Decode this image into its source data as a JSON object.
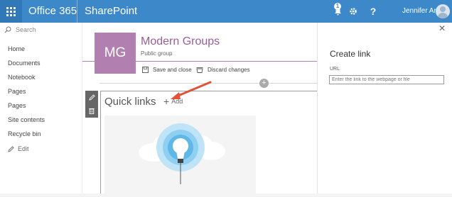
{
  "topbar": {
    "app_name": "Office 365",
    "product": "SharePoint",
    "notification_count": "1",
    "help_label": "?",
    "user_name": "Jennifer Ann"
  },
  "leftnav": {
    "search_placeholder": "Search",
    "items": [
      {
        "label": "Home"
      },
      {
        "label": "Documents"
      },
      {
        "label": "Notebook"
      },
      {
        "label": "Pages"
      },
      {
        "label": "Pages"
      },
      {
        "label": "Site contents"
      },
      {
        "label": "Recycle bin"
      }
    ],
    "edit_label": "Edit"
  },
  "site": {
    "logo_initials": "MG",
    "title": "Modern Groups",
    "subtitle": "Public group",
    "logo_color": "#b17fb0"
  },
  "commands": {
    "save_label": "Save and close",
    "discard_label": "Discard changes"
  },
  "webpart": {
    "title": "Quick links",
    "add_label": "Add"
  },
  "panel": {
    "title": "Create link",
    "url_label": "URL",
    "url_placeholder": "Enter the link to the webpage or file",
    "url_value": ""
  },
  "colors": {
    "topbar": "#3d88c8",
    "accent": "#b17fb0",
    "arrow": "#e0533a"
  }
}
